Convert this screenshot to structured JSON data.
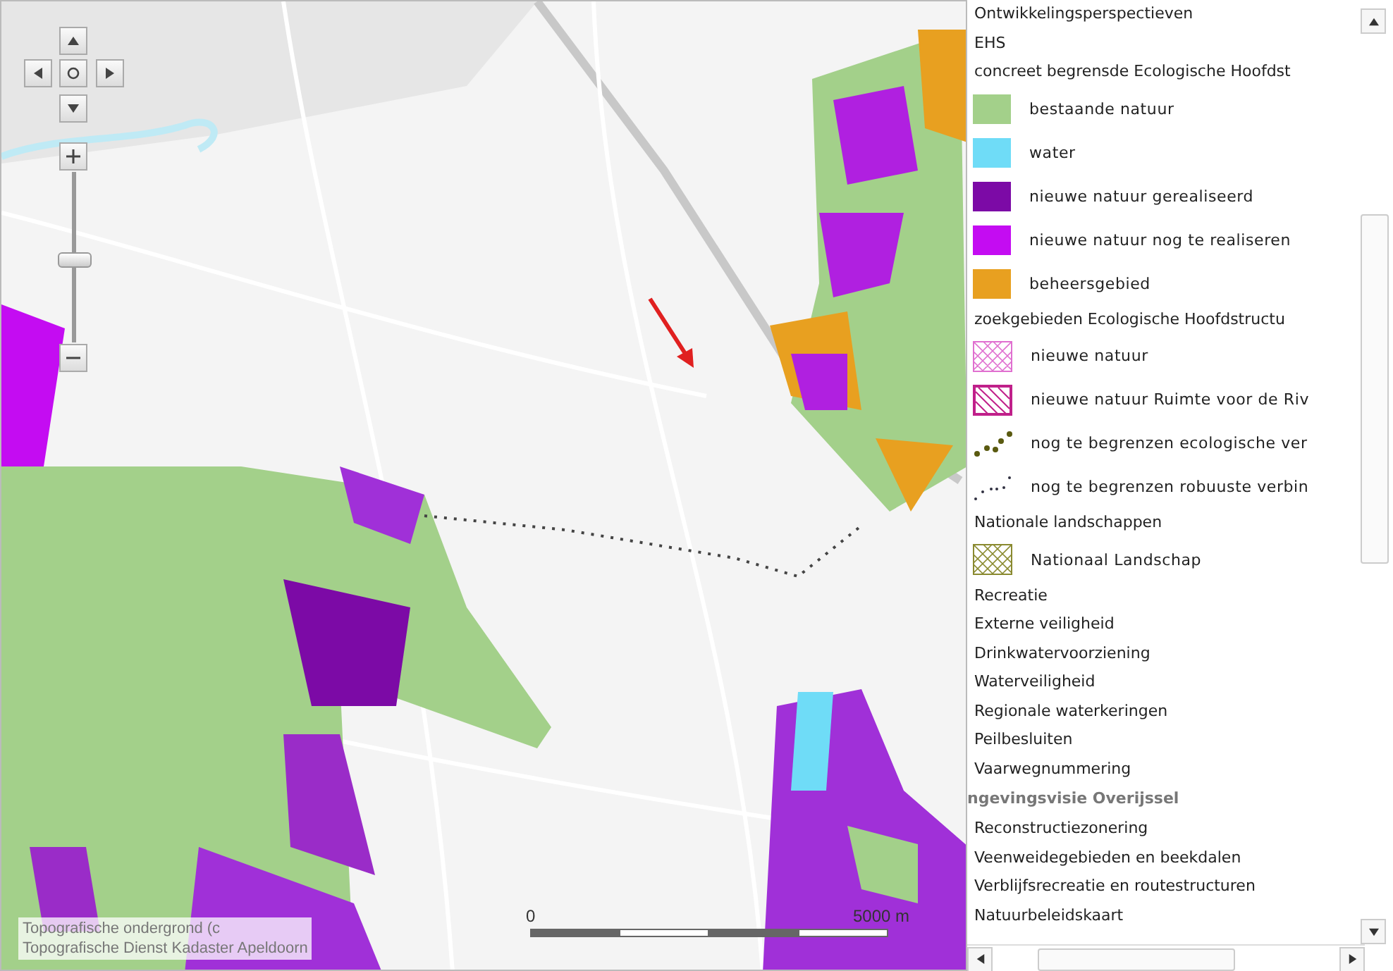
{
  "map": {
    "attribution": [
      "Topografische ondergrond (c",
      "Topografische Dienst Kadaster Apeldoorn"
    ],
    "scale": {
      "start": "0",
      "end": "5000 m"
    },
    "zoom": {
      "level": 0.5
    }
  },
  "legend": {
    "items": [
      {
        "kind": "heading",
        "label": "Ontwikkelingsperspectieven"
      },
      {
        "kind": "heading",
        "label": "EHS"
      },
      {
        "kind": "heading",
        "label": "concreet begrensde Ecologische Hoofdst"
      },
      {
        "kind": "swatch",
        "color": "#a3d08a",
        "label": "bestaande natuur"
      },
      {
        "kind": "swatch",
        "color": "#6fdcf7",
        "label": "water"
      },
      {
        "kind": "swatch",
        "color": "#7c0aa6",
        "label": "nieuwe natuur gerealiseerd"
      },
      {
        "kind": "swatch",
        "color": "#c40cf2",
        "label": "nieuwe natuur nog te realiseren"
      },
      {
        "kind": "swatch",
        "color": "#e8a020",
        "label": "beheersgebied"
      },
      {
        "kind": "heading",
        "label": "zoekgebieden Ecologische Hoofdstructu"
      },
      {
        "kind": "crosshatch",
        "color": "#e070d0",
        "label": "nieuwe natuur"
      },
      {
        "kind": "diagonal",
        "color": "#c0208a",
        "label": "nieuwe natuur Ruimte voor de Riv"
      },
      {
        "kind": "bigdots",
        "color": "#5a5a10",
        "label": "nog te begrenzen ecologische ver"
      },
      {
        "kind": "smalldots",
        "color": "#303040",
        "label": "nog te begrenzen robuuste verbin"
      },
      {
        "kind": "heading",
        "label": "Nationale landschappen"
      },
      {
        "kind": "crosshatch",
        "color": "#8a8a30",
        "label": "Nationaal Landschap"
      },
      {
        "kind": "heading",
        "label": "Recreatie"
      },
      {
        "kind": "heading",
        "label": "Externe veiligheid"
      },
      {
        "kind": "heading",
        "label": "Drinkwatervoorziening"
      },
      {
        "kind": "heading",
        "label": "Waterveiligheid"
      },
      {
        "kind": "heading",
        "label": "Regionale waterkeringen"
      },
      {
        "kind": "heading",
        "label": "Peilbesluiten"
      },
      {
        "kind": "heading",
        "label": "Vaarwegnummering"
      },
      {
        "kind": "group",
        "label": "ngevingsvisie Overijssel"
      },
      {
        "kind": "heading",
        "label": "Reconstructiezonering"
      },
      {
        "kind": "heading",
        "label": "Veenweidegebieden en beekdalen"
      },
      {
        "kind": "heading",
        "label": "Verblijfsrecreatie en routestructuren"
      },
      {
        "kind": "heading",
        "label": "Natuurbeleidskaart"
      }
    ]
  }
}
